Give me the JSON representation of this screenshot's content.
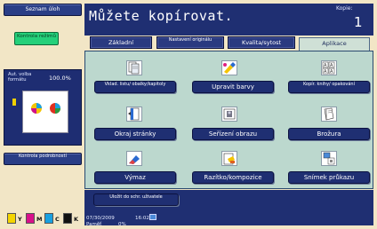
{
  "left": {
    "job_list_label": "Seznam úloh",
    "check_settings_label": "Kontrola režimů",
    "auto_format_label": "Aut. volba formátu",
    "zoom_value": "100.0%",
    "check_details_label": "Kontrola podrobností"
  },
  "header": {
    "title": "Můžete kopírovat.",
    "copies_label": "Kopie:",
    "copies_value": "1"
  },
  "tabs": [
    {
      "label": "Základní"
    },
    {
      "label": "Nastavení originálu"
    },
    {
      "label": "Kvalita/sytost"
    },
    {
      "label": "Aplikace"
    }
  ],
  "functions": [
    {
      "label": "Vklad. listu/ obalky/kapitoly",
      "icon": "insert-sheet-icon"
    },
    {
      "label": "Upravit barvy",
      "icon": "color-adjust-icon"
    },
    {
      "label": "Kopír. knihy/ opakování",
      "icon": "book-copy-icon"
    },
    {
      "label": "Okraj stránky",
      "icon": "page-margin-icon"
    },
    {
      "label": "Seřízení obrazu",
      "icon": "image-adjust-icon"
    },
    {
      "label": "Brožura",
      "icon": "booklet-icon"
    },
    {
      "label": "Výmaz",
      "icon": "erase-icon"
    },
    {
      "label": "Razítko/kompozice",
      "icon": "stamp-icon"
    },
    {
      "label": "Snímek průkazu",
      "icon": "card-shot-icon"
    },
    {
      "label": "Uložit do schr. uživatele",
      "icon": "save-box-icon"
    }
  ],
  "status": {
    "date": "07/30/2009",
    "time": "16:02",
    "memory_label": "Paměť",
    "memory_value": "0%"
  },
  "toners": [
    {
      "label": "Y",
      "color": "#f4d400"
    },
    {
      "label": "M",
      "color": "#d8108a"
    },
    {
      "label": "C",
      "color": "#18a0e0"
    },
    {
      "label": "K",
      "color": "#111111"
    }
  ]
}
